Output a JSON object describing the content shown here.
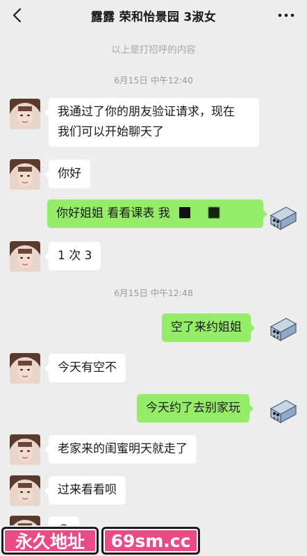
{
  "header": {
    "title": "露露 荣和怡景园 3淑女",
    "back_icon": "chevron-left-icon",
    "more_icon": "more-dots-icon"
  },
  "system_notice": "以上是打招呼的内容",
  "timestamps": [
    "6月15日 中午12:40",
    "6月15日 中午12:48"
  ],
  "messages": [
    {
      "side": "left",
      "lines": [
        "我通过了你的朋友验证请求，现在",
        "我们可以开始聊天了"
      ]
    },
    {
      "side": "left",
      "text": "你好"
    },
    {
      "side": "right",
      "text": "你好姐姐 看看课表 我"
    },
    {
      "side": "left",
      "text": "1 次 3"
    },
    {
      "side": "right",
      "text": "空了来约姐姐"
    },
    {
      "side": "left",
      "text": "今天有空不"
    },
    {
      "side": "right",
      "text": "今天约了去别家玩"
    },
    {
      "side": "left",
      "text": "老家来的闺蜜明天就走了"
    },
    {
      "side": "left",
      "text": "过来看看呗"
    },
    {
      "side": "left",
      "text": "😀"
    }
  ],
  "banner": {
    "left": "永久地址",
    "right": "69sm.cc",
    "color": "#e94b87"
  },
  "colors": {
    "self_bubble": "#95ec69",
    "other_bubble": "#ffffff",
    "background": "#ededed"
  }
}
